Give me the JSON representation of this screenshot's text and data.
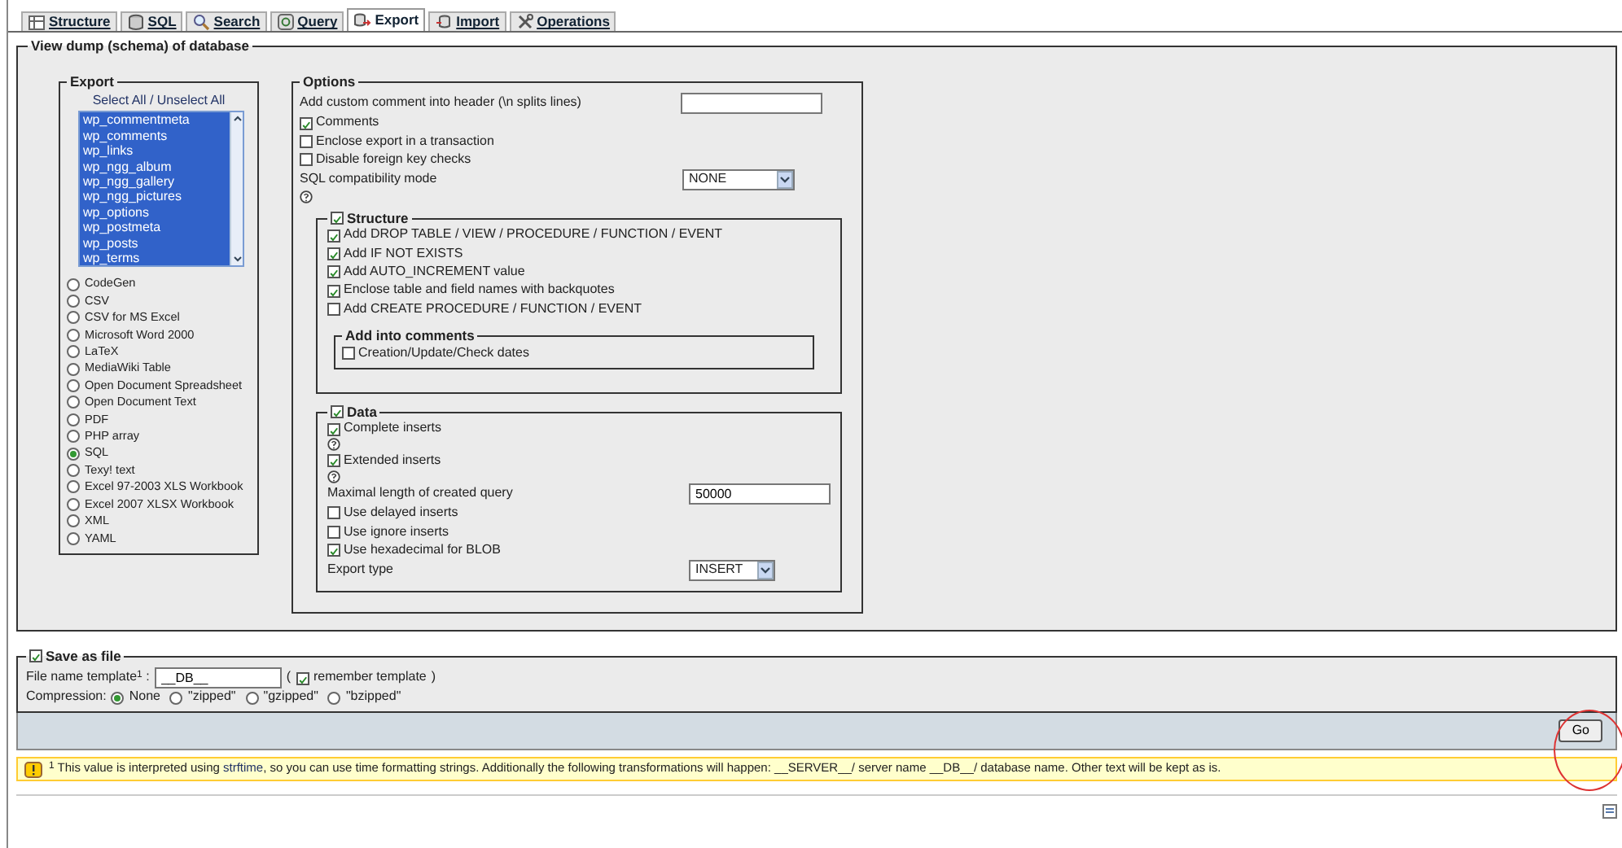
{
  "tabs": [
    {
      "label": "Structure",
      "selected": false
    },
    {
      "label": "SQL",
      "selected": false
    },
    {
      "label": "Search",
      "selected": false
    },
    {
      "label": "Query",
      "selected": false
    },
    {
      "label": "Export",
      "selected": true
    },
    {
      "label": "Import",
      "selected": false
    },
    {
      "label": "Operations",
      "selected": false
    }
  ],
  "dump": {
    "legend": "View dump (schema) of database",
    "export": {
      "legend": "Export",
      "select_all": "Select All / Unselect All",
      "tables": [
        {
          "name": "wp_commentmeta",
          "selected": true
        },
        {
          "name": "wp_comments",
          "selected": true
        },
        {
          "name": "wp_links",
          "selected": true
        },
        {
          "name": "wp_ngg_album",
          "selected": true
        },
        {
          "name": "wp_ngg_gallery",
          "selected": true
        },
        {
          "name": "wp_ngg_pictures",
          "selected": true
        },
        {
          "name": "wp_options",
          "selected": true
        },
        {
          "name": "wp_postmeta",
          "selected": true
        },
        {
          "name": "wp_posts",
          "selected": true
        },
        {
          "name": "wp_terms",
          "selected": true
        }
      ],
      "formats": [
        {
          "label": "CodeGen",
          "selected": false
        },
        {
          "label": "CSV",
          "selected": false
        },
        {
          "label": "CSV for MS Excel",
          "selected": false
        },
        {
          "label": "Microsoft Word 2000",
          "selected": false
        },
        {
          "label": "LaTeX",
          "selected": false
        },
        {
          "label": "MediaWiki Table",
          "selected": false
        },
        {
          "label": "Open Document Spreadsheet",
          "selected": false
        },
        {
          "label": "Open Document Text",
          "selected": false
        },
        {
          "label": "PDF",
          "selected": false
        },
        {
          "label": "PHP array",
          "selected": false
        },
        {
          "label": "SQL",
          "selected": true
        },
        {
          "label": "Texy! text",
          "selected": false
        },
        {
          "label": "Excel 97-2003 XLS Workbook",
          "selected": false
        },
        {
          "label": "Excel 2007 XLSX Workbook",
          "selected": false
        },
        {
          "label": "XML",
          "selected": false
        },
        {
          "label": "YAML",
          "selected": false
        }
      ]
    },
    "options": {
      "legend": "Options",
      "items": [
        {
          "kind": "text",
          "label": "Add custom comment into header (\\n splits lines)"
        },
        {
          "kind": "checkbox",
          "label": "Comments",
          "checked": true
        },
        {
          "kind": "checkbox",
          "label": "Enclose export in a transaction",
          "checked": false
        },
        {
          "kind": "checkbox",
          "label": "Disable foreign key checks",
          "checked": false
        },
        {
          "kind": "select",
          "label": "SQL compatibility mode",
          "value": "NONE",
          "help": true
        }
      ],
      "structure": {
        "label": "Structure",
        "checked": true,
        "items": [
          {
            "label": "Add DROP TABLE / VIEW / PROCEDURE / FUNCTION / EVENT",
            "checked": true
          },
          {
            "label": "Add IF NOT EXISTS",
            "checked": true
          },
          {
            "label": "Add AUTO_INCREMENT value",
            "checked": true
          },
          {
            "label": "Enclose table and field names with backquotes",
            "checked": true
          },
          {
            "label": "Add CREATE PROCEDURE / FUNCTION / EVENT",
            "checked": false
          }
        ],
        "comments": {
          "legend": "Add into comments",
          "items": [
            {
              "label": "Creation/Update/Check dates",
              "checked": false
            }
          ]
        }
      },
      "data": {
        "label": "Data",
        "checked": true,
        "items": [
          {
            "kind": "checkbox",
            "label": "Complete inserts",
            "checked": true,
            "help": true
          },
          {
            "kind": "checkbox",
            "label": "Extended inserts",
            "checked": true,
            "help": true
          },
          {
            "kind": "text",
            "label": "Maximal length of created query",
            "value": "50000"
          },
          {
            "kind": "checkbox",
            "label": "Use delayed inserts",
            "checked": false
          },
          {
            "kind": "checkbox",
            "label": "Use ignore inserts",
            "checked": false
          },
          {
            "kind": "checkbox",
            "label": "Use hexadecimal for BLOB",
            "checked": true
          },
          {
            "kind": "select",
            "label": "Export type",
            "value": "INSERT"
          }
        ]
      }
    }
  },
  "save": {
    "label": "Save as file",
    "checked": true,
    "template_label": "File name template$^{1}$ :",
    "template_value": "__DB__",
    "open_paren": "(",
    "remember": {
      "label": "remember template",
      "checked": true
    },
    "close_paren": ")",
    "compression_label": "Compression:",
    "compression": [
      {
        "label": "None",
        "selected": true
      },
      {
        "label": "\"zipped\"",
        "selected": false
      },
      {
        "label": "\"gzipped\"",
        "selected": false
      },
      {
        "label": "\"bzipped\"",
        "selected": false
      }
    ]
  },
  "go": "Go",
  "note": {
    "before": "$^{1}$ This value is interpreted using ",
    "link": "strftime",
    "after": ", so you can use time formatting strings. Additionally the following transformations will happen: __SERVER__/ server name __DB__/ database name. Other text will be kept as is."
  }
}
